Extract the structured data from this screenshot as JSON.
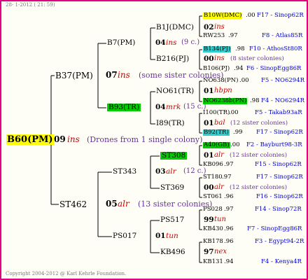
{
  "header": {
    "date_line": "28- 1-2012 ( 21: 59)"
  },
  "footer": {
    "copyright": "Copyright 2004-2012 @ Karl Kehrle Foundation."
  },
  "colors": {
    "frame": "#e0007f",
    "yellow": "#ffff00",
    "green": "#00cc00",
    "cyan": "#33cccc"
  },
  "root": {
    "name": "B60(PM)",
    "year": "09",
    "breeder": "ins",
    "note": "(Drones from 1 single colony)"
  },
  "gen1": {
    "top": {
      "name": "B37(PM)",
      "year": "07",
      "breeder": "ins",
      "note": "(some sister colonies)"
    },
    "bottom": {
      "name": "ST462",
      "year": "05",
      "breeder": "alr",
      "note": "(13 sister colonies)"
    }
  },
  "gen2": {
    "a": {
      "name": "B7(PM)",
      "year": "04",
      "breeder": "ins",
      "note": "(9 c.)"
    },
    "b": {
      "name": "B93(TR)",
      "year": "04",
      "breeder": "mrk",
      "note": "(15 c.)"
    },
    "c": {
      "name": "ST343",
      "year": "03",
      "breeder": "alr",
      "note": "(12 c.)"
    },
    "d": {
      "name": "PS017",
      "year": "01",
      "breeder": "tun"
    }
  },
  "gen3": [
    {
      "name": "B1J(DMC)",
      "year": "02",
      "breeder": "ins"
    },
    {
      "name": "B216(PJ)",
      "year": "00",
      "breeder": "ins",
      "note": "(8 sister colonies)"
    },
    {
      "name": "NO61(TR)",
      "year": "01",
      "breeder": "hbpn"
    },
    {
      "name": "I89(TR)",
      "year": "01",
      "breeder": "bal",
      "note": "(12 sister colonies)"
    },
    {
      "name": "ST308",
      "year": "01",
      "breeder": "alr",
      "note": "(12 sister colonies)"
    },
    {
      "name": "ST369",
      "year": "00",
      "breeder": "alr",
      "note": "(12 sister colonies)"
    },
    {
      "name": "PS517",
      "year": "99",
      "breeder": "tun"
    },
    {
      "name": "KB496",
      "year": "97",
      "breeder": "nex"
    }
  ],
  "gen4": [
    {
      "name": "B10W(DMC)",
      "year": ".00",
      "ref": "F17 - Sinop62R"
    },
    {
      "name": "RW253",
      "year": ".97",
      "ref": "F8 - Atlas85R"
    },
    {
      "name": "B134(PJ)",
      "year": ".98",
      "ref": "F10 - AthosSt80R"
    },
    {
      "name": "B106(PJ)",
      "year": ".94",
      "ref": "F6 - SinopEgg86R"
    },
    {
      "name": "NO638(PN)",
      "year": ".00",
      "ref": "F5 - NO6294R"
    },
    {
      "name": "NO6238b(PN)",
      "year": ".98",
      "ref": "F4 - NO6294R"
    },
    {
      "name": "I100(TR)",
      "year": ".00",
      "ref": "F5 - Takab93aR"
    },
    {
      "name": "B92(TR)",
      "year": ".99",
      "ref": "F17 - Sinop62R"
    },
    {
      "name": "A40(GB)",
      "year": ".00",
      "ref": "F2 - Bayburt98-3R"
    },
    {
      "name": "KB096",
      "year": ".97",
      "ref": "F15 - Sinop62R"
    },
    {
      "name": "ST180",
      "year": ".97",
      "ref": "F17 - Sinop62R"
    },
    {
      "name": "ST061",
      "year": ".96",
      "ref": "F16 - Sinop62R"
    },
    {
      "name": "PS028",
      "year": ".97",
      "ref": "F14 - Sinop72R"
    },
    {
      "name": "KB430",
      "year": ".96",
      "ref": "F7 - SinopEgg86R"
    },
    {
      "name": "KB178",
      "year": ".96",
      "ref": "F3 - Egypt94-2R"
    },
    {
      "name": "KB131",
      "year": ".94",
      "ref": "F4 - Kenya4R"
    }
  ]
}
